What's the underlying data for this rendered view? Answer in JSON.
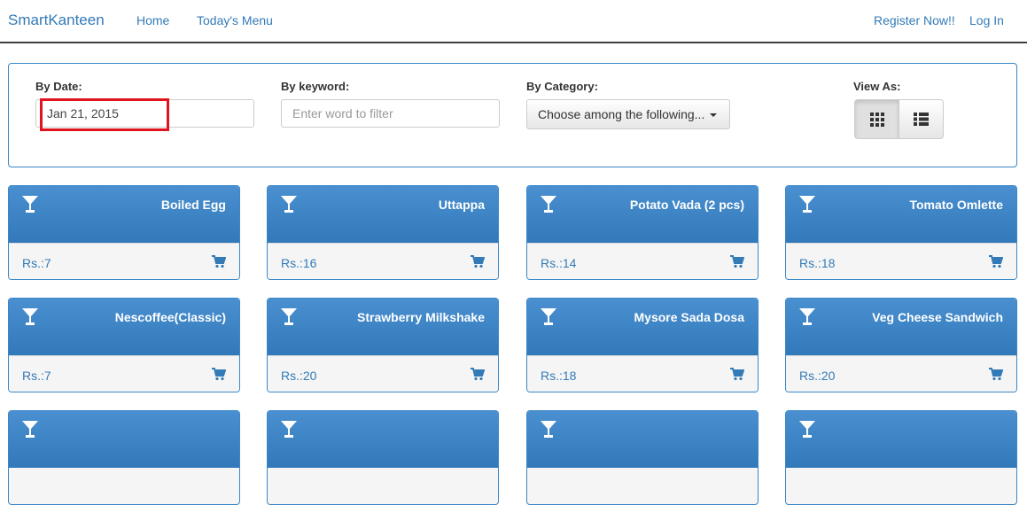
{
  "navbar": {
    "brand": "SmartKanteen",
    "links": [
      "Home",
      "Today's Menu"
    ],
    "right_links": [
      "Register Now!!",
      "Log In"
    ]
  },
  "filters": {
    "date_label": "By Date:",
    "date_value": "Jan 21, 2015",
    "keyword_label": "By keyword:",
    "keyword_placeholder": "Enter word to filter",
    "category_label": "By Category:",
    "category_value": "Choose among the following...",
    "view_label": "View As:",
    "view_icons": [
      "grid-view-icon",
      "list-view-icon"
    ]
  },
  "items": [
    {
      "name": "Boiled Egg",
      "price": "Rs.:7"
    },
    {
      "name": "Uttappa",
      "price": "Rs.:16"
    },
    {
      "name": "Potato Vada (2 pcs)",
      "price": "Rs.:14"
    },
    {
      "name": "Tomato Omlette",
      "price": "Rs.:18"
    },
    {
      "name": "Nescoffee(Classic)",
      "price": "Rs.:7"
    },
    {
      "name": "Strawberry Milkshake",
      "price": "Rs.:20"
    },
    {
      "name": "Mysore Sada Dosa",
      "price": "Rs.:18"
    },
    {
      "name": "Veg Cheese Sandwich",
      "price": "Rs.:20"
    }
  ],
  "colors": {
    "primary": "#337ab7",
    "card_header": "#3a87c8",
    "highlight": "#e0141f"
  }
}
